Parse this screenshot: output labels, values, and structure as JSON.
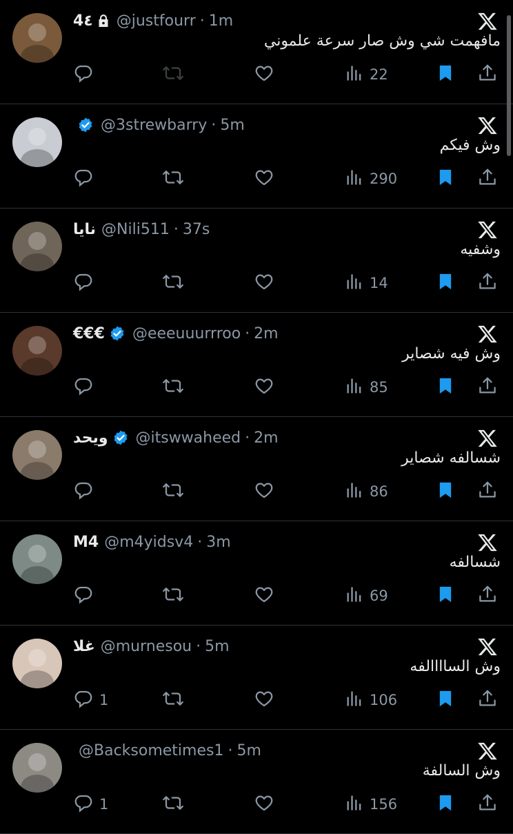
{
  "tweets": [
    {
      "name": "4٤",
      "lock": true,
      "verified": false,
      "handle": "@justfourr",
      "time": "1m",
      "text": "مافهمت شي وش صار سرعة علموني",
      "replies": "",
      "retweets": "",
      "views": "22",
      "avatar_color": "#7a5a3a",
      "retweet_dim": true
    },
    {
      "name": "",
      "lock": false,
      "verified": true,
      "handle": "@3strewbarry",
      "time": "5m",
      "text": "وش فيكم",
      "replies": "",
      "retweets": "",
      "views": "290",
      "avatar_color": "#c9ccd2",
      "retweet_dim": false
    },
    {
      "name": "نايا",
      "lock": false,
      "verified": false,
      "handle": "@Nili511",
      "time": "37s",
      "text": "وشفيه",
      "replies": "",
      "retweets": "",
      "views": "14",
      "avatar_color": "#6f6558",
      "retweet_dim": false
    },
    {
      "name": "€€€",
      "lock": false,
      "verified": true,
      "handle": "@eeeuuurrroo",
      "time": "2m",
      "text": "وش فيه شصاير",
      "replies": "",
      "retweets": "",
      "views": "85",
      "avatar_color": "#5a3a2a",
      "retweet_dim": false
    },
    {
      "name": "ويحد",
      "lock": false,
      "verified": true,
      "handle": "@itswwaheed",
      "time": "2m",
      "text": "شسالفه شصاير",
      "replies": "",
      "retweets": "",
      "views": "86",
      "avatar_color": "#8a7b6a",
      "retweet_dim": false
    },
    {
      "name": "M4",
      "lock": false,
      "verified": false,
      "handle": "@m4yidsv4",
      "time": "3m",
      "text": "شسالفه",
      "replies": "",
      "retweets": "",
      "views": "69",
      "avatar_color": "#7d8a86",
      "retweet_dim": false
    },
    {
      "name": "غلا",
      "lock": false,
      "verified": false,
      "handle": "@murnesou",
      "time": "5m",
      "text": "وش الساااالفه",
      "replies": "1",
      "retweets": "",
      "views": "106",
      "avatar_color": "#d8c6b8",
      "retweet_dim": false
    },
    {
      "name": "",
      "lock": false,
      "verified": false,
      "handle": "@Backsometimes1",
      "time": "5m",
      "text": "وش السالفة",
      "replies": "1",
      "retweets": "",
      "views": "156",
      "avatar_color": "#8d8a84",
      "retweet_dim": false
    }
  ],
  "separator": "·",
  "colors": {
    "accent": "#1d9bf0",
    "muted": "#8b98a5",
    "text": "#e7e9ea",
    "divider": "#2f3336"
  },
  "icons": [
    "x-logo-icon",
    "reply-icon",
    "retweet-icon",
    "like-icon",
    "views-icon",
    "bookmark-icon",
    "share-icon",
    "lock-icon",
    "verified-badge-icon"
  ]
}
